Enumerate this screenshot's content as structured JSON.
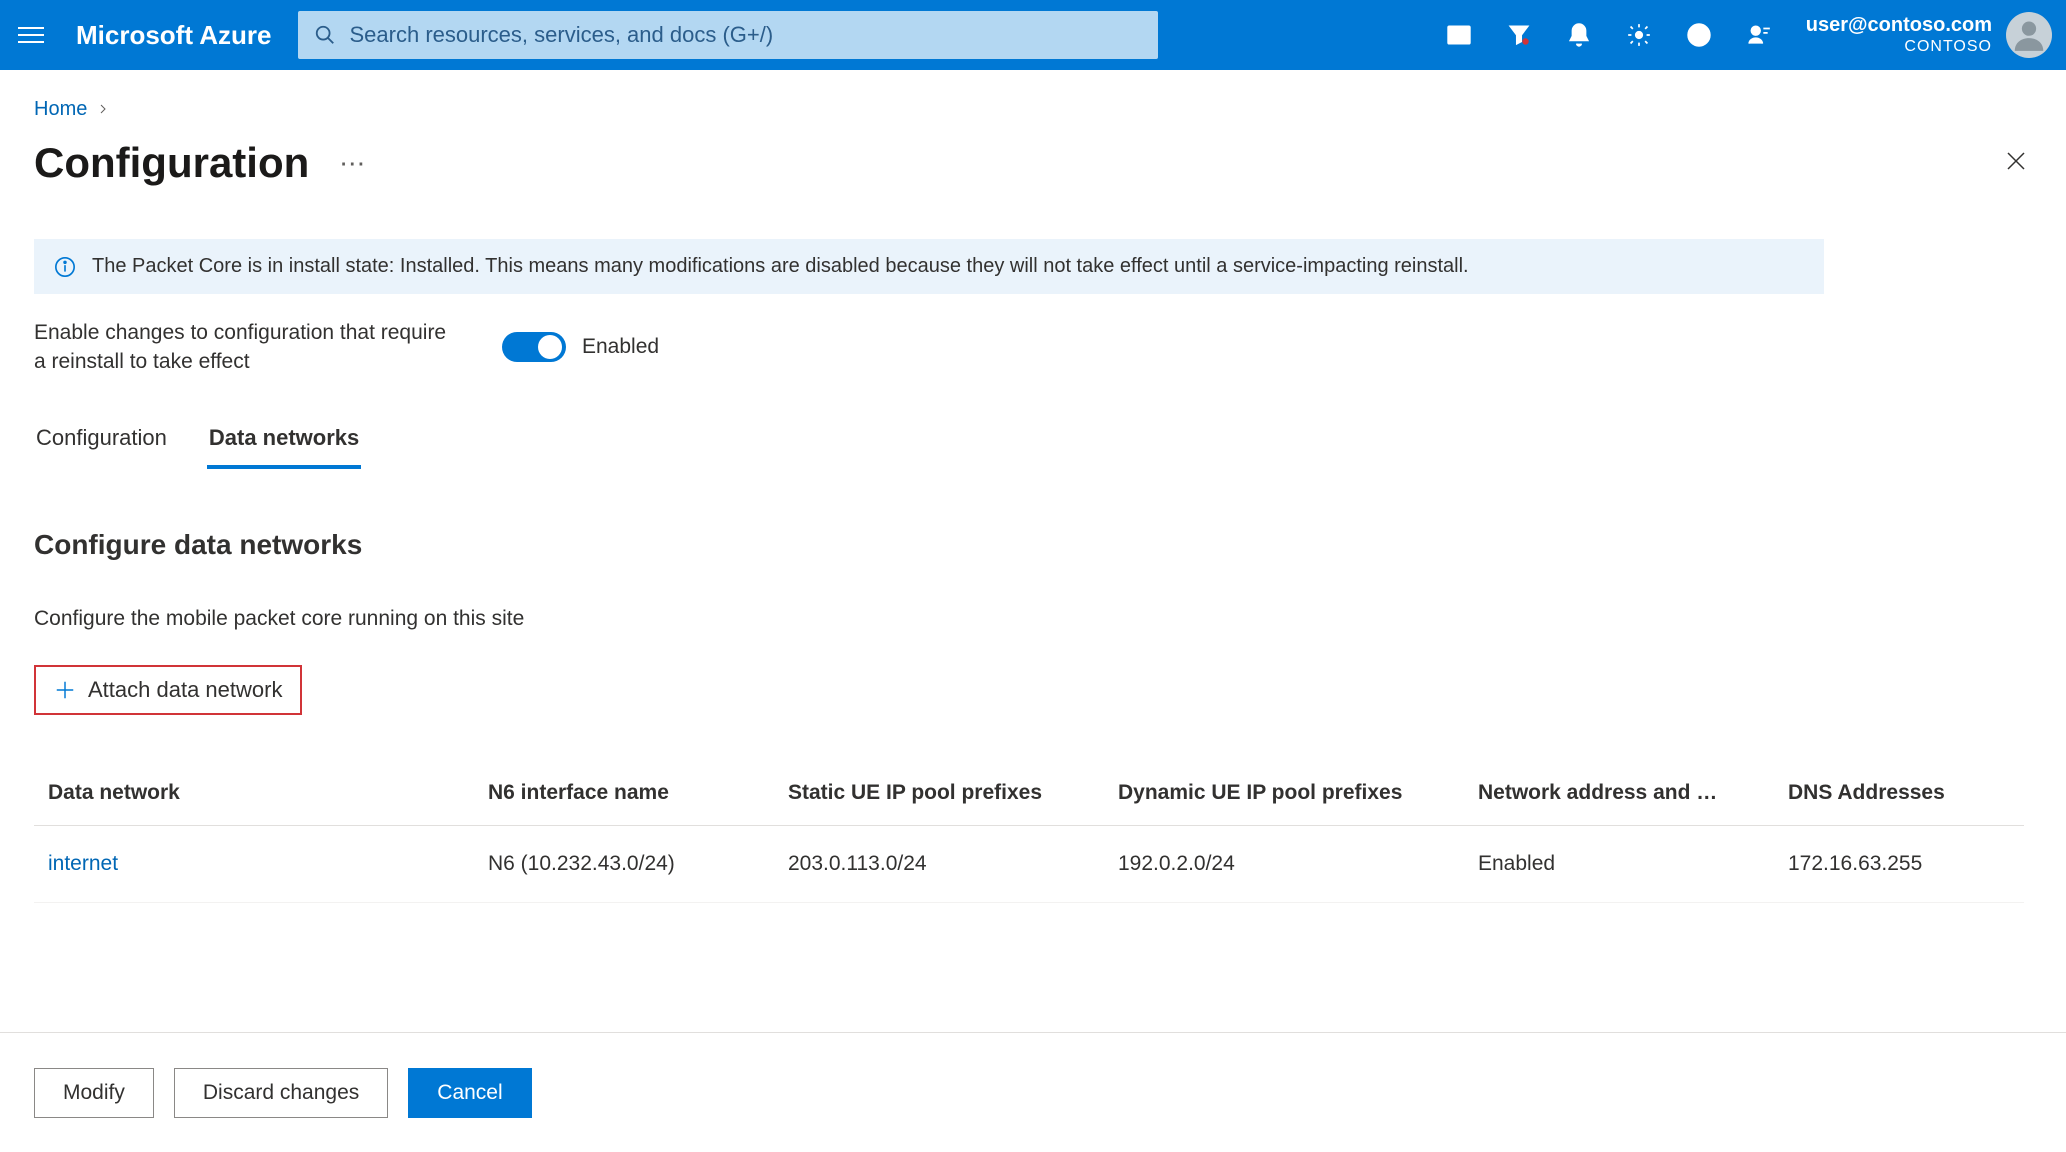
{
  "header": {
    "brand": "Microsoft Azure",
    "search_placeholder": "Search resources, services, and docs (G+/)",
    "account_email": "user@contoso.com",
    "account_org": "CONTOSO"
  },
  "breadcrumb": {
    "home": "Home"
  },
  "page": {
    "title": "Configuration"
  },
  "banner": {
    "text": "The Packet Core is in install state: Installed. This means many modifications are disabled because they will not take effect until a service-impacting reinstall."
  },
  "toggle": {
    "label": "Enable changes to configuration that require a reinstall to take effect",
    "state": "Enabled"
  },
  "tabs": {
    "configuration": "Configuration",
    "data_networks": "Data networks"
  },
  "section": {
    "heading": "Configure data networks",
    "description": "Configure the mobile packet core running on this site"
  },
  "attach_button": "Attach data network",
  "table": {
    "columns": {
      "data_network": "Data network",
      "n6": "N6 interface name",
      "static_prefixes": "Static UE IP pool prefixes",
      "dynamic_prefixes": "Dynamic UE IP pool prefixes",
      "nat": "Network address and …",
      "dns": "DNS Addresses"
    },
    "rows": [
      {
        "data_network": "internet",
        "n6": "N6 (10.232.43.0/24)",
        "static_prefixes": "203.0.113.0/24",
        "dynamic_prefixes": "192.0.2.0/24",
        "nat": "Enabled",
        "dns": "172.16.63.255"
      }
    ]
  },
  "footer": {
    "modify": "Modify",
    "discard": "Discard changes",
    "cancel": "Cancel"
  }
}
